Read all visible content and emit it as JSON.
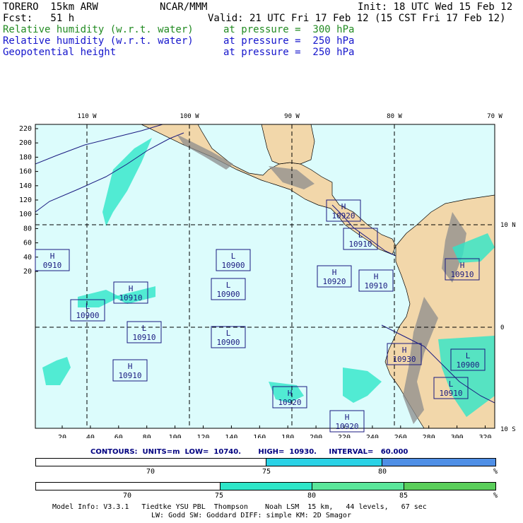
{
  "header": {
    "model": "TORERO  15km ARW",
    "org": "NCAR/MMM",
    "init": "Init: 18 UTC Wed 15 Feb 12",
    "fcst": "Fcst:   51 h",
    "valid": "Valid: 21 UTC Fri 17 Feb 12 (15 CST Fri 17 Feb 12)",
    "fields": [
      {
        "name": "Relative humidity (w.r.t. water)",
        "level": "at pressure =  300 hPa",
        "color": "#228B22"
      },
      {
        "name": "Relative humidity (w.r.t. water)",
        "level": "at pressure =  250 hPa",
        "color": "#1515CC"
      },
      {
        "name": "Geopotential height",
        "level": "at pressure =  250 hPa",
        "color": "#1515CC"
      }
    ]
  },
  "map": {
    "lon_labels": [
      "110 W",
      "100 W",
      "90 W",
      "80 W",
      "70 W"
    ],
    "lat_labels": [
      "10 N",
      "0",
      "10 S"
    ],
    "y_ticks": [
      "220",
      "200",
      "180",
      "160",
      "140",
      "120",
      "100",
      "80",
      "60",
      "40",
      "20"
    ],
    "x_ticks": [
      "20",
      "40",
      "60",
      "80",
      "100",
      "120",
      "140",
      "160",
      "180",
      "200",
      "220",
      "240",
      "260",
      "280",
      "300",
      "320"
    ],
    "colors": {
      "ocean": "#dcfcfc",
      "land": "#f2d7aa",
      "mountain": "#8c8c8c",
      "contour": "#1a1a80",
      "grid": "#000000"
    },
    "centers": [
      {
        "type": "H",
        "value": "10920"
      },
      {
        "type": "L",
        "value": "10910"
      },
      {
        "type": "H",
        "value": "0910"
      },
      {
        "type": "L",
        "value": "10900"
      },
      {
        "type": "H",
        "value": "10920"
      },
      {
        "type": "H",
        "value": "10910"
      },
      {
        "type": "H",
        "value": "10910"
      },
      {
        "type": "H",
        "value": "10910"
      },
      {
        "type": "L",
        "value": "10900"
      },
      {
        "type": "L",
        "value": "10900"
      },
      {
        "type": "L",
        "value": "10910"
      },
      {
        "type": "L",
        "value": "10900"
      },
      {
        "type": "H",
        "value": "10930"
      },
      {
        "type": "L",
        "value": "10900"
      },
      {
        "type": "H",
        "value": "10910"
      },
      {
        "type": "L",
        "value": "10910"
      },
      {
        "type": "H",
        "value": "10920"
      },
      {
        "type": "H",
        "value": "10920"
      }
    ]
  },
  "contours_line": "CONTOURS:  UNITS=m  LOW=  10740.       HIGH=  10930.     INTERVAL=   60.000",
  "colorbar1": {
    "ticks": [
      "70",
      "75",
      "80"
    ],
    "unit": "%",
    "segments": [
      {
        "color": "#ffffff"
      },
      {
        "color": "#2ad2e6"
      },
      {
        "color": "#4f8fe6"
      }
    ]
  },
  "colorbar2": {
    "ticks": [
      "70",
      "75",
      "80",
      "85"
    ],
    "unit": "%",
    "segments": [
      {
        "color": "#ffffff"
      },
      {
        "color": "#2ee6c8"
      },
      {
        "color": "#5ae69a"
      },
      {
        "color": "#5ace5a"
      }
    ]
  },
  "footer": {
    "line1": "Model Info: V3.3.1   Tiedtke YSU PBL  Thompson    Noah LSM  15 km,   44 levels,   67 sec",
    "line2": "LW: Godd SW: Goddard DIFF: simple KM: 2D Smagor"
  }
}
